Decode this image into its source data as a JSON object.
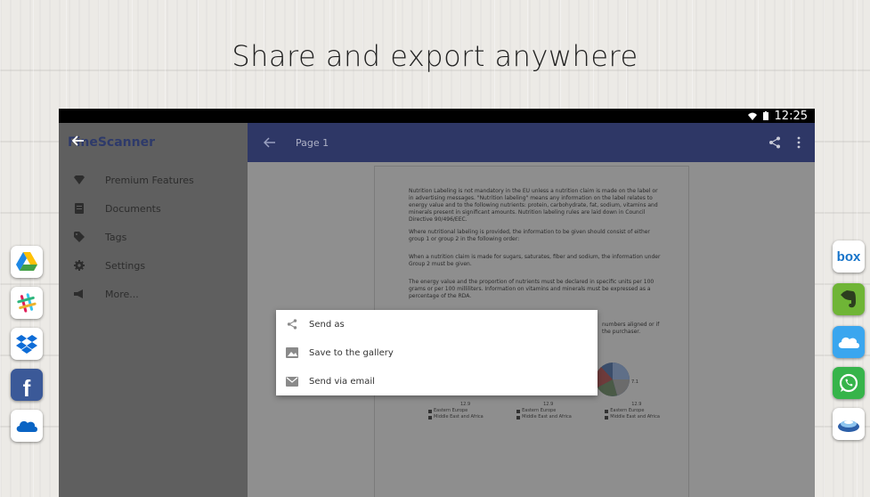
{
  "headline": "Share and export anywhere",
  "statusbar": {
    "time": "12:25"
  },
  "drawer": {
    "app_name": "FineScanner",
    "items": [
      {
        "label": "Premium Features",
        "icon": "diamond-icon"
      },
      {
        "label": "Documents",
        "icon": "document-icon"
      },
      {
        "label": "Tags",
        "icon": "tag-icon"
      },
      {
        "label": "Settings",
        "icon": "gear-icon"
      },
      {
        "label": "More...",
        "icon": "megaphone-icon"
      }
    ]
  },
  "appbar": {
    "title": "Page 1"
  },
  "document": {
    "paragraphs": [
      "Nutrition Labeling is not mandatory in the EU unless a nutrition claim is made on the label or in advertising messages. \"Nutrition labeling\" means any information on the label relates to energy value and to the following nutrients: protein, carbohydrate, fat, sodium, vitamins and minerals present in significant amounts. Nutrition labeling rules are laid down in Council Directive 90/496/EEC.",
      "Where nutritional labeling is provided, the information to be given should consist of either group 1 or group 2 in the following order:",
      "When a nutrition claim is made for sugars, saturates, fiber and sodium, the information under Group 2 must be given.",
      "The energy value and the proportion of nutrients must be declared in specific units per 100 grams or per 100 milliliters. Information on vitamins and minerals must be expressed as a percentage of the RDA."
    ],
    "fragment_1": "numbers aligned or if",
    "fragment_2": "the purchaser.",
    "chart_labels": [
      "12.9",
      "12.9",
      "12.9",
      "7.1"
    ],
    "legend": {
      "eastern": "Eastern Europe",
      "middle": "Middle East and Africa"
    }
  },
  "menu": {
    "items": [
      {
        "label": "Send as",
        "icon": "share-icon"
      },
      {
        "label": "Save to the gallery",
        "icon": "image-icon"
      },
      {
        "label": "Send via email",
        "icon": "email-icon"
      }
    ]
  },
  "left_apps": [
    "google-drive-icon",
    "slack-icon",
    "dropbox-icon",
    "facebook-icon",
    "onedrive-icon"
  ],
  "right_apps": [
    "box-icon",
    "evernote-icon",
    "icloud-icon",
    "whatsapp-icon",
    "yandex-disk-icon"
  ],
  "box_label": "box",
  "facebook_label": "f",
  "colors": {
    "appbar": "#2e3766",
    "drawer": "#5f5f5f",
    "menu_bg": "#ffffff"
  }
}
